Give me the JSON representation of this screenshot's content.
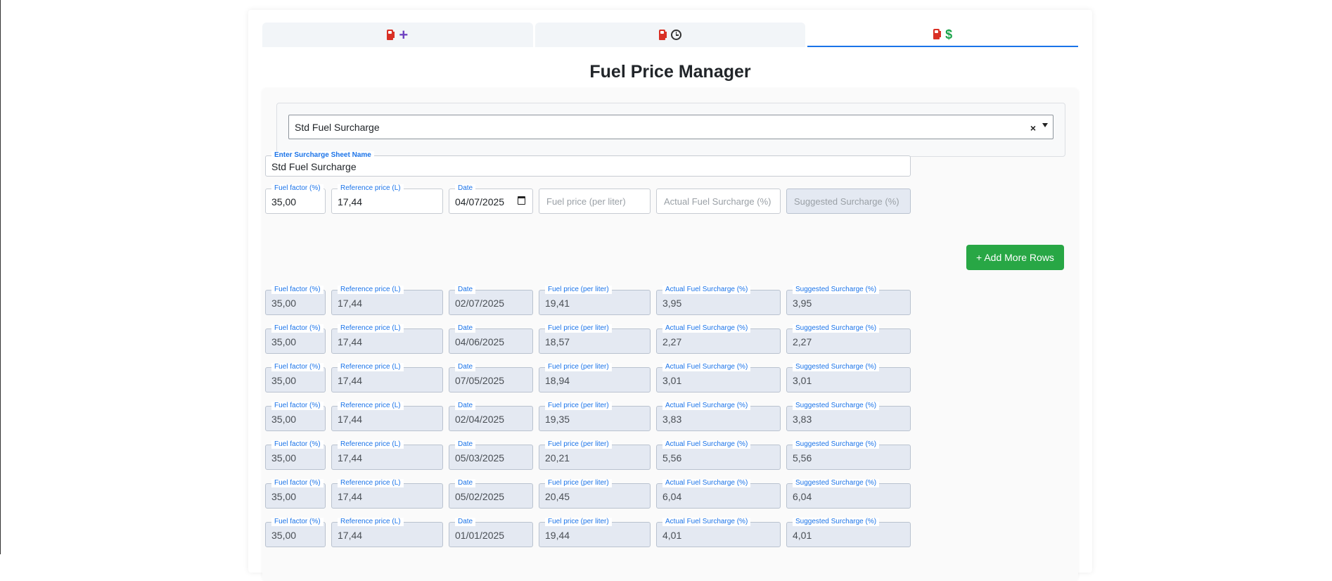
{
  "tabs": [
    {
      "id": "add",
      "icons": [
        "fuel-pump-icon",
        "plus-icon"
      ]
    },
    {
      "id": "history",
      "icons": [
        "fuel-pump-icon",
        "clock-icon"
      ]
    },
    {
      "id": "price",
      "icons": [
        "fuel-pump-icon",
        "dollar-icon"
      ],
      "active": true
    }
  ],
  "page_title": "Fuel Price Manager",
  "sheet_select": {
    "selected": "Std Fuel Surcharge",
    "clear_glyph": "×"
  },
  "sheet_name": {
    "label": "Enter Surcharge Sheet Name",
    "value": "Std Fuel Surcharge"
  },
  "labels": {
    "fuel_factor": "Fuel factor (%)",
    "reference_price": "Reference price (L)",
    "date": "Date",
    "fuel_price": "Fuel price (per liter)",
    "actual_surcharge": "Actual Fuel Surcharge (%)",
    "suggested_surcharge": "Suggested Surcharge (%)"
  },
  "entry": {
    "fuel_factor": "35,00",
    "reference_price": "17,44",
    "date": "04/07/2025",
    "fuel_price_placeholder": "Fuel price (per liter)",
    "actual_surcharge_placeholder": "Actual Fuel Surcharge (%)",
    "suggested_surcharge_placeholder": "Suggested Surcharge (%)"
  },
  "add_rows_label": "+ Add More Rows",
  "rows": [
    {
      "fuel_factor": "35,00",
      "reference_price": "17,44",
      "date": "02/07/2025",
      "fuel_price": "19,41",
      "actual_surcharge": "3,95",
      "suggested_surcharge": "3,95"
    },
    {
      "fuel_factor": "35,00",
      "reference_price": "17,44",
      "date": "04/06/2025",
      "fuel_price": "18,57",
      "actual_surcharge": "2,27",
      "suggested_surcharge": "2,27"
    },
    {
      "fuel_factor": "35,00",
      "reference_price": "17,44",
      "date": "07/05/2025",
      "fuel_price": "18,94",
      "actual_surcharge": "3,01",
      "suggested_surcharge": "3,01"
    },
    {
      "fuel_factor": "35,00",
      "reference_price": "17,44",
      "date": "02/04/2025",
      "fuel_price": "19,35",
      "actual_surcharge": "3,83",
      "suggested_surcharge": "3,83"
    },
    {
      "fuel_factor": "35,00",
      "reference_price": "17,44",
      "date": "05/03/2025",
      "fuel_price": "20,21",
      "actual_surcharge": "5,56",
      "suggested_surcharge": "5,56"
    },
    {
      "fuel_factor": "35,00",
      "reference_price": "17,44",
      "date": "05/02/2025",
      "fuel_price": "20,45",
      "actual_surcharge": "6,04",
      "suggested_surcharge": "6,04"
    },
    {
      "fuel_factor": "35,00",
      "reference_price": "17,44",
      "date": "01/01/2025",
      "fuel_price": "19,44",
      "actual_surcharge": "4,01",
      "suggested_surcharge": "4,01"
    }
  ],
  "colors": {
    "accent": "#1a73e8",
    "add_button": "#28a745",
    "readonly_bg": "#e4e9f2"
  }
}
